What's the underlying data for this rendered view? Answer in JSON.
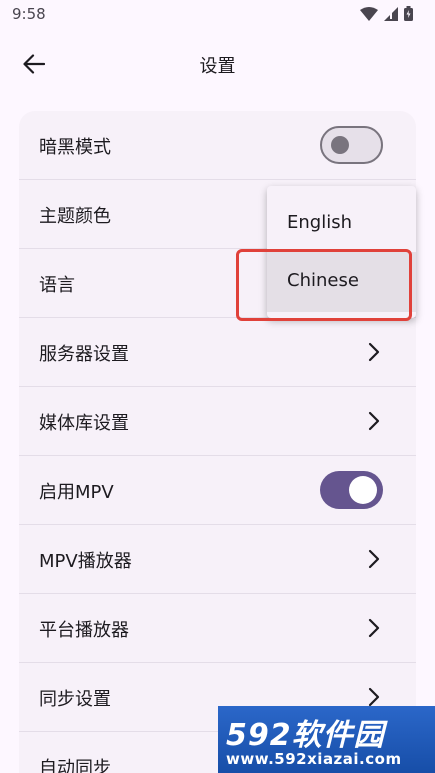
{
  "status_bar": {
    "time": "9:58"
  },
  "app_bar": {
    "title": "设置"
  },
  "settings": [
    {
      "label": "暗黑模式",
      "control": "switch",
      "on": false
    },
    {
      "label": "主题颜色",
      "control": "none"
    },
    {
      "label": "语言",
      "control": "none"
    },
    {
      "label": "服务器设置",
      "control": "chevron"
    },
    {
      "label": "媒体库设置",
      "control": "chevron"
    },
    {
      "label": "启用MPV",
      "control": "switch",
      "on": true
    },
    {
      "label": "MPV播放器",
      "control": "chevron"
    },
    {
      "label": "平台播放器",
      "control": "chevron"
    },
    {
      "label": "同步设置",
      "control": "chevron"
    },
    {
      "label": "自动同步",
      "control": "none"
    }
  ],
  "language_menu": {
    "options": [
      "English",
      "Chinese"
    ],
    "selected": "Chinese"
  },
  "watermark": {
    "brand": "592软件园",
    "url": "www.592xiazai.com"
  },
  "colors": {
    "accent": "#65558f",
    "surface": "#f7f1f9",
    "highlight": "#e0413a"
  }
}
